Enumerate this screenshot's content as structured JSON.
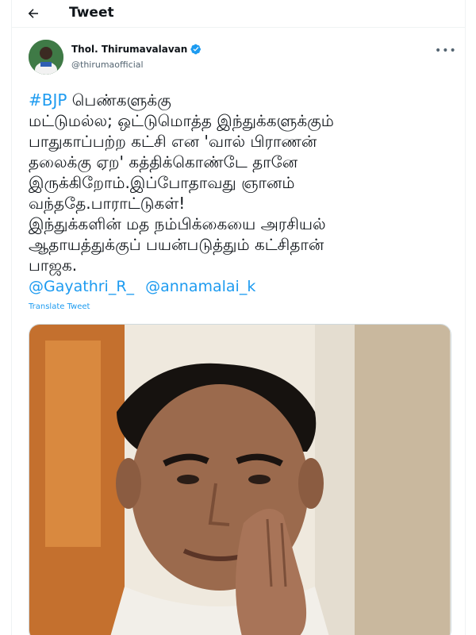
{
  "topbar": {
    "title": "Tweet"
  },
  "author": {
    "name": "Thol. Thirumavalavan",
    "handle": "@thirumaofficial"
  },
  "tweet": {
    "hashtag": "#BJP",
    "line1_rest": " பெண்களுக்கு",
    "lines": [
      "மட்டுமல்ல; ஒட்டுமொத்த இந்துக்களுக்கும்",
      "பாதுகாப்பற்ற கட்சி என 'வால் பிராணன்",
      "தலைக்கு ஏற' கத்திக்கொண்டே தானே",
      "இருக்கிறோம்.இப்போதாவது ஞானம்",
      "வந்ததே.பாராட்டுகள்!",
      "இந்துக்களின் மத நம்பிக்கையை அரசியல்",
      "ஆதாயத்துக்குப் பயன்படுத்தும் கட்சிதான்",
      "பாஜக."
    ],
    "mentions": [
      "@Gayathri_R_",
      "@annamalai_k"
    ],
    "translate": "Translate Tweet"
  },
  "colors": {
    "link": "#1d9bf0",
    "text": "#0f1419",
    "muted": "#536471"
  }
}
